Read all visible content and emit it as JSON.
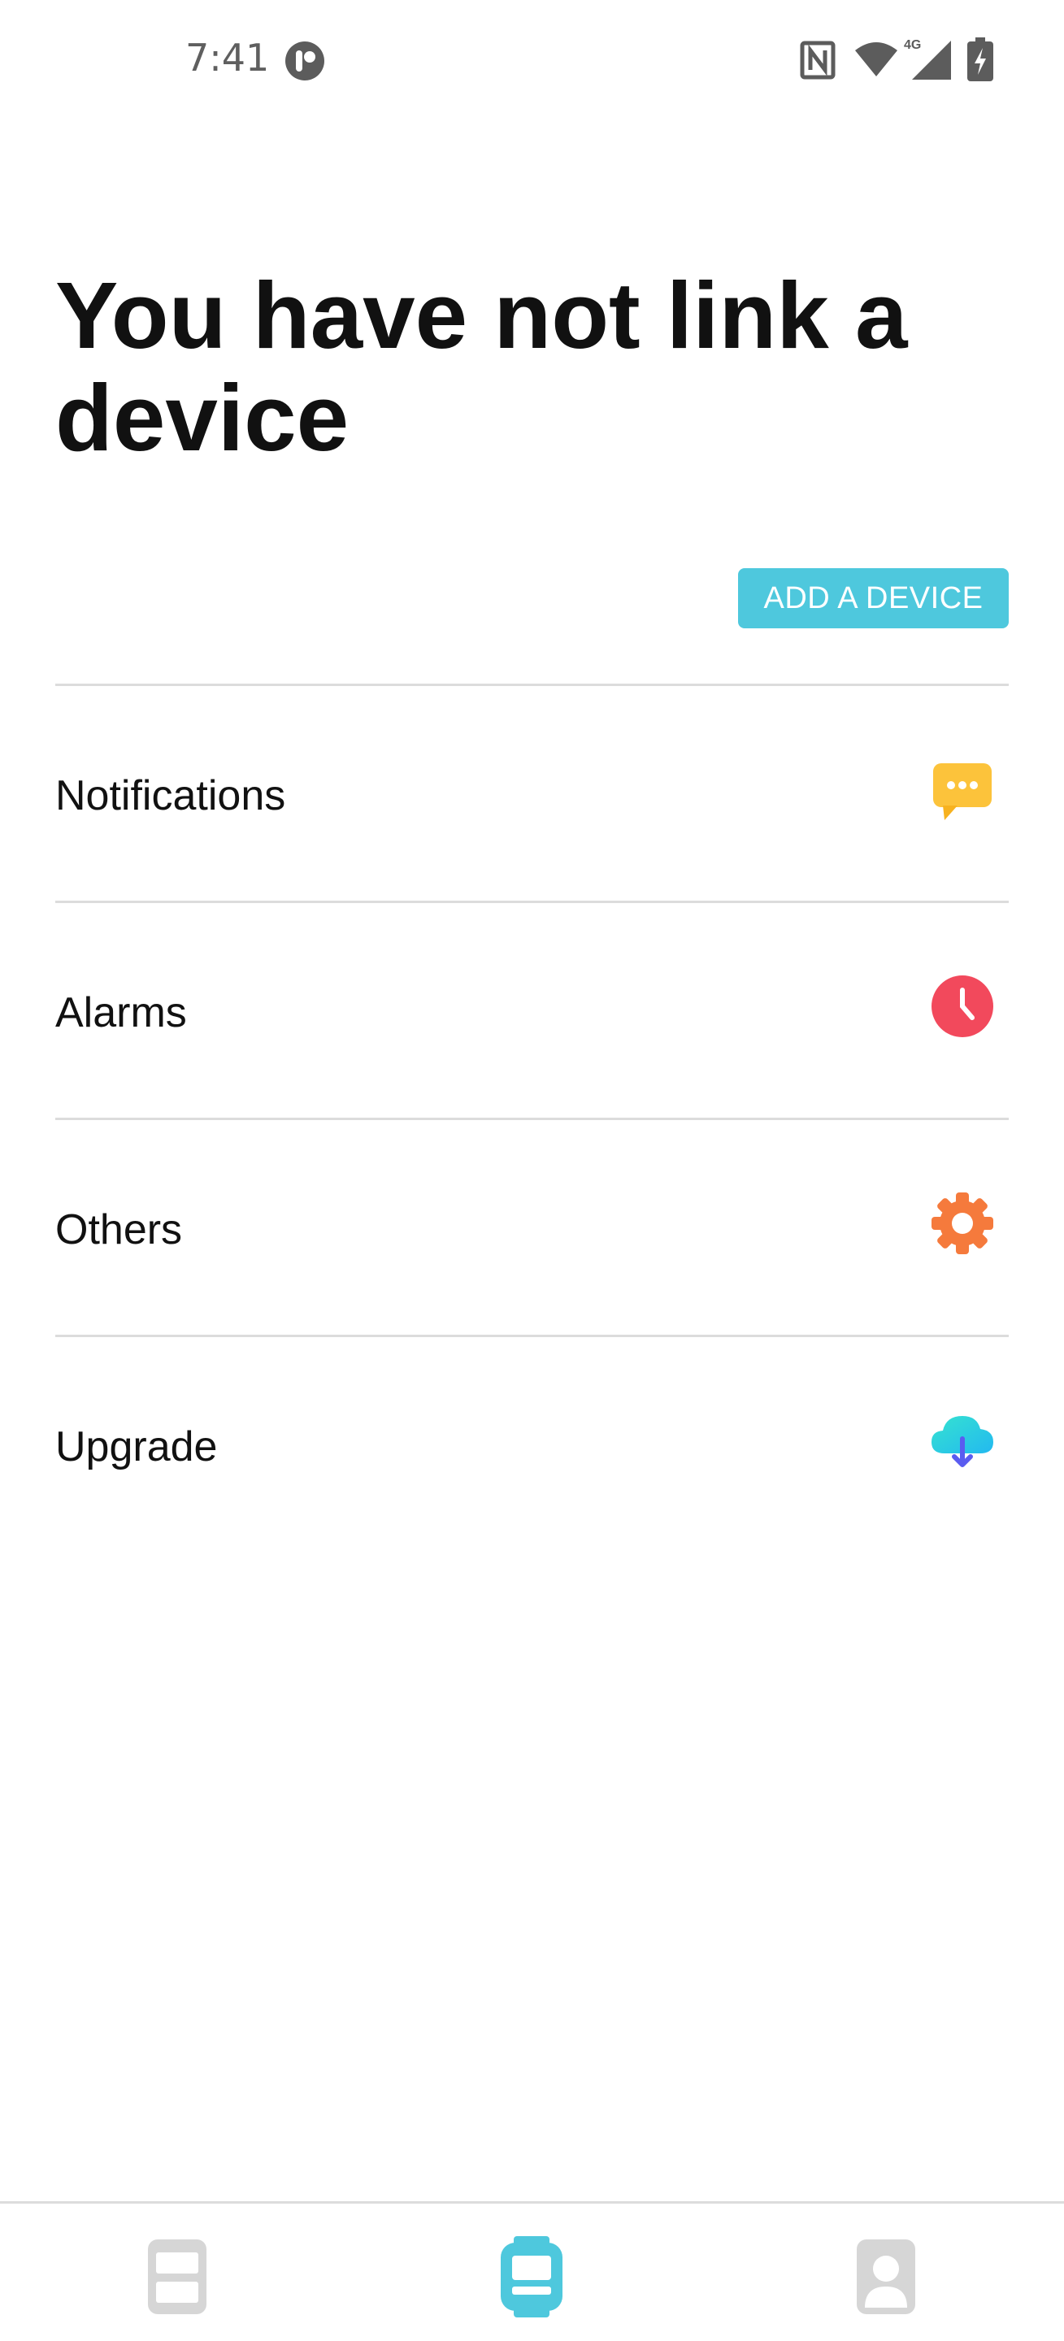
{
  "status_bar": {
    "time": "7:41",
    "icons": [
      "app-notification-icon",
      "nfc-icon",
      "wifi-icon",
      "signal-4g-icon",
      "battery-charging-icon"
    ],
    "signal_label": "4G"
  },
  "main": {
    "title": "You have not link a device",
    "add_button_label": "ADD A DEVICE"
  },
  "menu": {
    "items": [
      {
        "label": "Notifications",
        "icon": "chat-bubble-icon",
        "color": "#fcc33b"
      },
      {
        "label": "Alarms",
        "icon": "clock-icon",
        "color": "#f2495c"
      },
      {
        "label": "Others",
        "icon": "gear-icon",
        "color": "#f57a3c"
      },
      {
        "label": "Upgrade",
        "icon": "cloud-download-icon",
        "color": "#2fd7df"
      }
    ]
  },
  "tab_bar": {
    "tabs": [
      {
        "icon": "dashboard-icon",
        "active": false
      },
      {
        "icon": "watch-icon",
        "active": true
      },
      {
        "icon": "profile-icon",
        "active": false
      }
    ],
    "active_color": "#4ec8dd",
    "inactive_color": "#d6d6d6"
  },
  "colors": {
    "accent": "#4ec8dd",
    "divider": "#dcdcdc"
  }
}
